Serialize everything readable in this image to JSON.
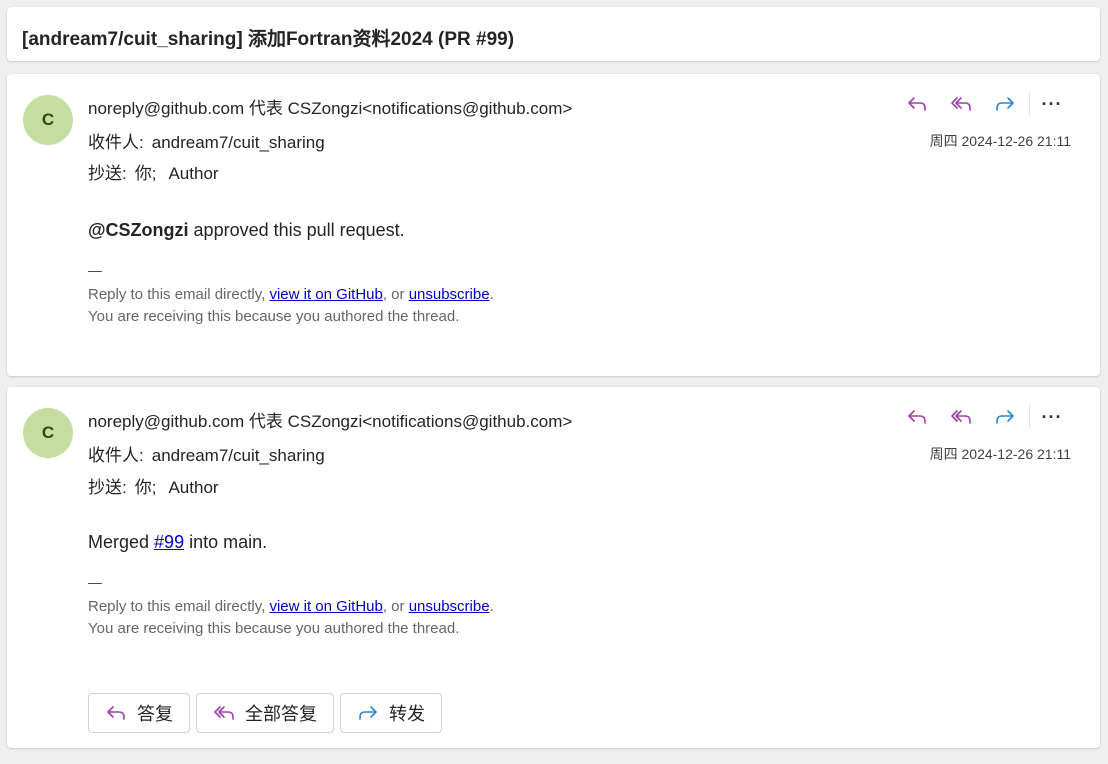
{
  "subject": "[andream7/cuit_sharing] 添加Fortran资料2024 (PR #99)",
  "colors": {
    "reply_icon": "#a23fae",
    "forward_icon": "#2a86d1",
    "avatar_bg": "#c5dea0",
    "link": "#0000cc"
  },
  "messages": [
    {
      "avatar_initial": "C",
      "from": "noreply@github.com 代表 CSZongzi<notifications@github.com>",
      "to_label": "收件人:",
      "to_value": "andream7/cuit_sharing",
      "cc_label": "抄送:",
      "cc_you": "你;",
      "cc_other": "Author",
      "date": "周四 2024-12-26 21:11",
      "body_bold": "@CSZongzi",
      "body_rest": " approved this pull request.",
      "dash": "—",
      "foot_prefix": "Reply to this email directly, ",
      "foot_link1": "view it on GitHub",
      "foot_mid": ", or ",
      "foot_link2": "unsubscribe",
      "foot_end": ".",
      "foot_line2": "You are receiving this because you authored the thread."
    },
    {
      "avatar_initial": "C",
      "from": "noreply@github.com 代表 CSZongzi<notifications@github.com>",
      "to_label": "收件人:",
      "to_value": "andream7/cuit_sharing",
      "cc_label": "抄送:",
      "cc_you": "你;",
      "cc_other": "Author",
      "date": "周四 2024-12-26 21:11",
      "body_pre": "Merged ",
      "body_link": "#99",
      "body_post": " into main.",
      "dash": "—",
      "foot_prefix": "Reply to this email directly, ",
      "foot_link1": "view it on GitHub",
      "foot_mid": ", or ",
      "foot_link2": "unsubscribe",
      "foot_end": ".",
      "foot_line2": "You are receiving this because you authored the thread."
    }
  ],
  "buttons": {
    "reply": "答复",
    "reply_all": "全部答复",
    "forward": "转发"
  },
  "icons": {
    "reply": "reply-icon",
    "reply_all": "reply-all-icon",
    "forward": "forward-icon",
    "more": "more-icon"
  }
}
